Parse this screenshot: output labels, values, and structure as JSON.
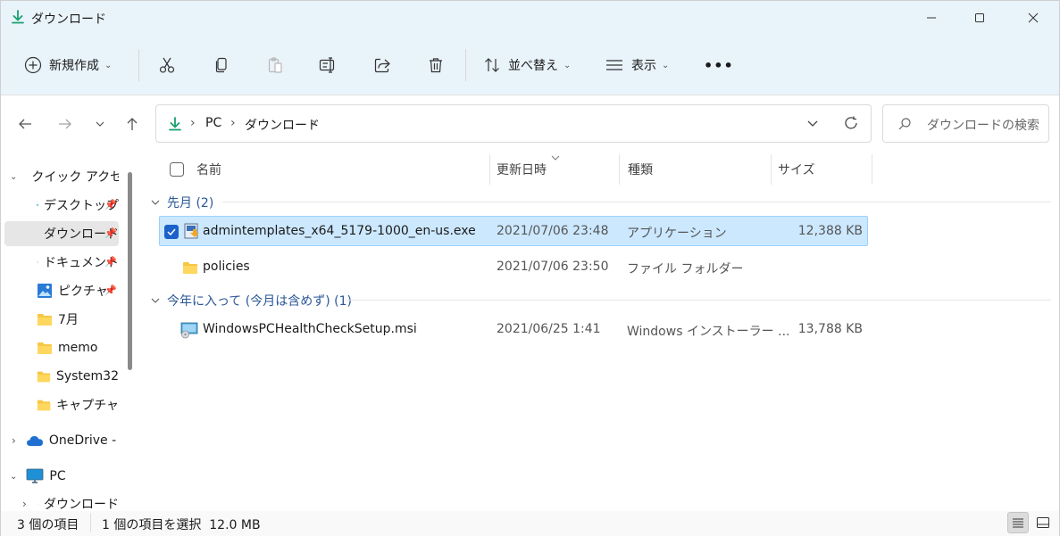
{
  "window": {
    "title": "ダウンロード",
    "accent": "#1aa06d"
  },
  "toolbar": {
    "new_label": "新規作成",
    "sort_label": "並べ替え",
    "view_label": "表示",
    "more_label": "•••"
  },
  "address": {
    "crumbs": [
      "PC",
      "ダウンロード"
    ],
    "separator": "›"
  },
  "search": {
    "placeholder": "ダウンロードの検索"
  },
  "sidebar": {
    "items": [
      {
        "label": "クイック アクセス",
        "icon": "star-icon"
      },
      {
        "label": "デスクトップ",
        "icon": "desktop-icon"
      },
      {
        "label": "ダウンロード",
        "icon": "download-icon"
      },
      {
        "label": "ドキュメント",
        "icon": "document-icon"
      },
      {
        "label": "ピクチャ",
        "icon": "picture-icon"
      },
      {
        "label": "7月",
        "icon": "folder-icon"
      },
      {
        "label": "memo",
        "icon": "folder-icon"
      },
      {
        "label": "System32",
        "icon": "folder-icon"
      },
      {
        "label": "キャプチャ",
        "icon": "folder-icon"
      },
      {
        "label": "OneDrive - ",
        "icon": "cloud-icon"
      },
      {
        "label": "PC",
        "icon": "pc-icon"
      },
      {
        "label": "ダウンロード",
        "icon": "download-icon"
      }
    ]
  },
  "columns": {
    "name": "名前",
    "date": "更新日時",
    "type": "種類",
    "size": "サイズ"
  },
  "groups": [
    {
      "label": "先月 (2)",
      "files": [
        {
          "name": "admintemplates_x64_5179-1000_en-us.exe",
          "date": "2021/07/06 23:48",
          "type": "アプリケーション",
          "size": "12,388 KB",
          "icon": "installer-icon",
          "selected": true
        },
        {
          "name": "policies",
          "date": "2021/07/06 23:50",
          "type": "ファイル フォルダー",
          "size": "",
          "icon": "folder-icon",
          "selected": false
        }
      ]
    },
    {
      "label": "今年に入って (今月は含めず) (1)",
      "files": [
        {
          "name": "WindowsPCHealthCheckSetup.msi",
          "date": "2021/06/25 1:41",
          "type": "Windows インストーラー ...",
          "size": "13,788 KB",
          "icon": "msi-icon",
          "selected": false
        }
      ]
    }
  ],
  "status": {
    "count": "3 個の項目",
    "selection": "1 個の項目を選択  12.0 MB"
  }
}
